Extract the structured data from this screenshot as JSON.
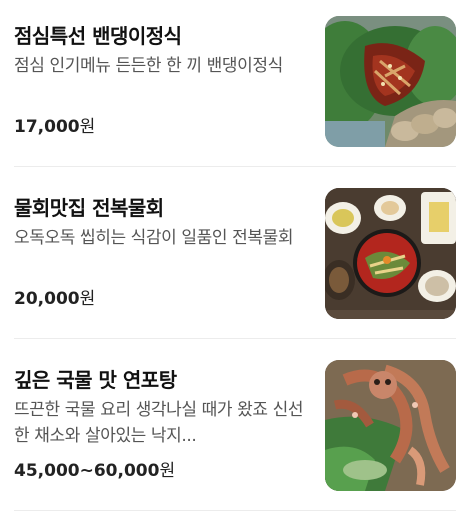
{
  "menu": {
    "items": [
      {
        "title": "점심특선 밴댕이정식",
        "description": "점심 인기메뉴 든든한 한 끼 밴댕이정식",
        "price_amount": "17,000",
        "price_unit": "원",
        "image_icon": "food-photo-icon"
      },
      {
        "title": "물회맛집 전복물회",
        "description": "오독오독 씹히는 식감이 일품인 전복물회",
        "price_amount": "20,000",
        "price_unit": "원",
        "image_icon": "food-photo-icon"
      },
      {
        "title": "깊은 국물 맛 연포탕",
        "description": "뜨끈한 국물 요리 생각나실 때가 왔죠 신선한 채소와 살아있는 낙지...",
        "price_amount": "45,000~60,000",
        "price_unit": "원",
        "image_icon": "food-photo-icon"
      }
    ]
  }
}
